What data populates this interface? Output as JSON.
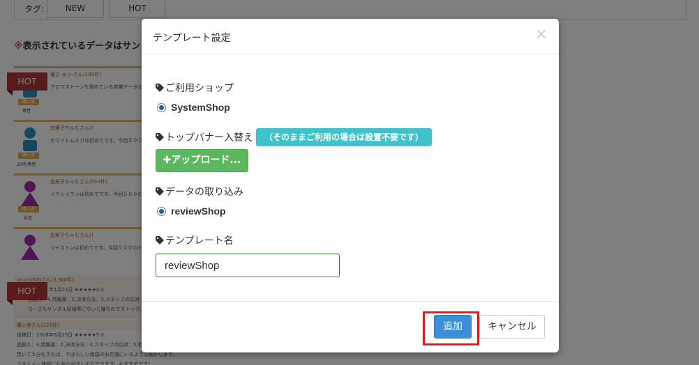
{
  "background": {
    "tag_label": "タグ:",
    "tags": [
      "NEW",
      "HOT"
    ],
    "notice_mark": "※",
    "notice_text": "表示されているデータはサン",
    "hot_label": "HOT",
    "reviews": [
      {
        "name": "優日-ぁぅ-さん(189件)",
        "text": "アロマストーンを探めている商業データが",
        "badge": "購入者",
        "gender": "男性"
      },
      {
        "name": "由美子ちゃむさん()",
        "text": "ホワイトムスクは初めてです。今回５００",
        "badge": "購入者",
        "gender": "20代/男性"
      },
      {
        "name": "由美子ちゃむさん(553件)",
        "text": "イランイランは初めてです。今回５００の",
        "badge": "購入者",
        "gender": "女性"
      },
      {
        "name": "由美子ちゃむさん()",
        "text": "ジャスミンは初めてです。今回５００のホ",
        "badge": "",
        "gender": ""
      }
    ],
    "reviews2": [
      {
        "name": "anan3343さん(3,360件)",
        "line1": "年1月21日 ★★★★★4.4",
        "line2": "品揃え：4,情報量：2,決済方法：3,スタッフの応対：5,梱",
        "line3": "ローズもサンダル同様常にないと嫌なのでストック。イン"
      },
      {
        "name": "購入者さん(123件)",
        "line1": "投稿日：2008年8月25日 ★★★★★5.0",
        "line2": "品揃え：4,情報量：2,決済方法：3,スタッフの応対：5,梱包",
        "line3": "焚いて５分もすれば、すばらしい南国のお花畑にいるような気がします。",
        "line4": "うまくよ一律側にも香りがぱんのりできます。おすすめです！"
      }
    ]
  },
  "modal": {
    "title": "テンプレート設定",
    "close_icon": "×",
    "shop_label": "ご利用ショップ",
    "shop_option": "SystemShop",
    "banner_label": "トップバナー入替え",
    "banner_note": "（そのままご利用の場合は設置不要です）",
    "upload_label": "✚アップロード...",
    "import_label": "データの取り込み",
    "import_option": "reviewShop",
    "template_name_label": "テンプレート名",
    "template_name_value": "reviewShop",
    "add_label": "追加",
    "cancel_label": "キャンセル"
  },
  "colors": {
    "overlay": "rgba(0,0,0,0.5)",
    "primary": "#3a8fd8",
    "success": "#5cb85c",
    "info": "#3ec2cc",
    "highlight": "#d81e1e",
    "hot": "#b0383a"
  }
}
